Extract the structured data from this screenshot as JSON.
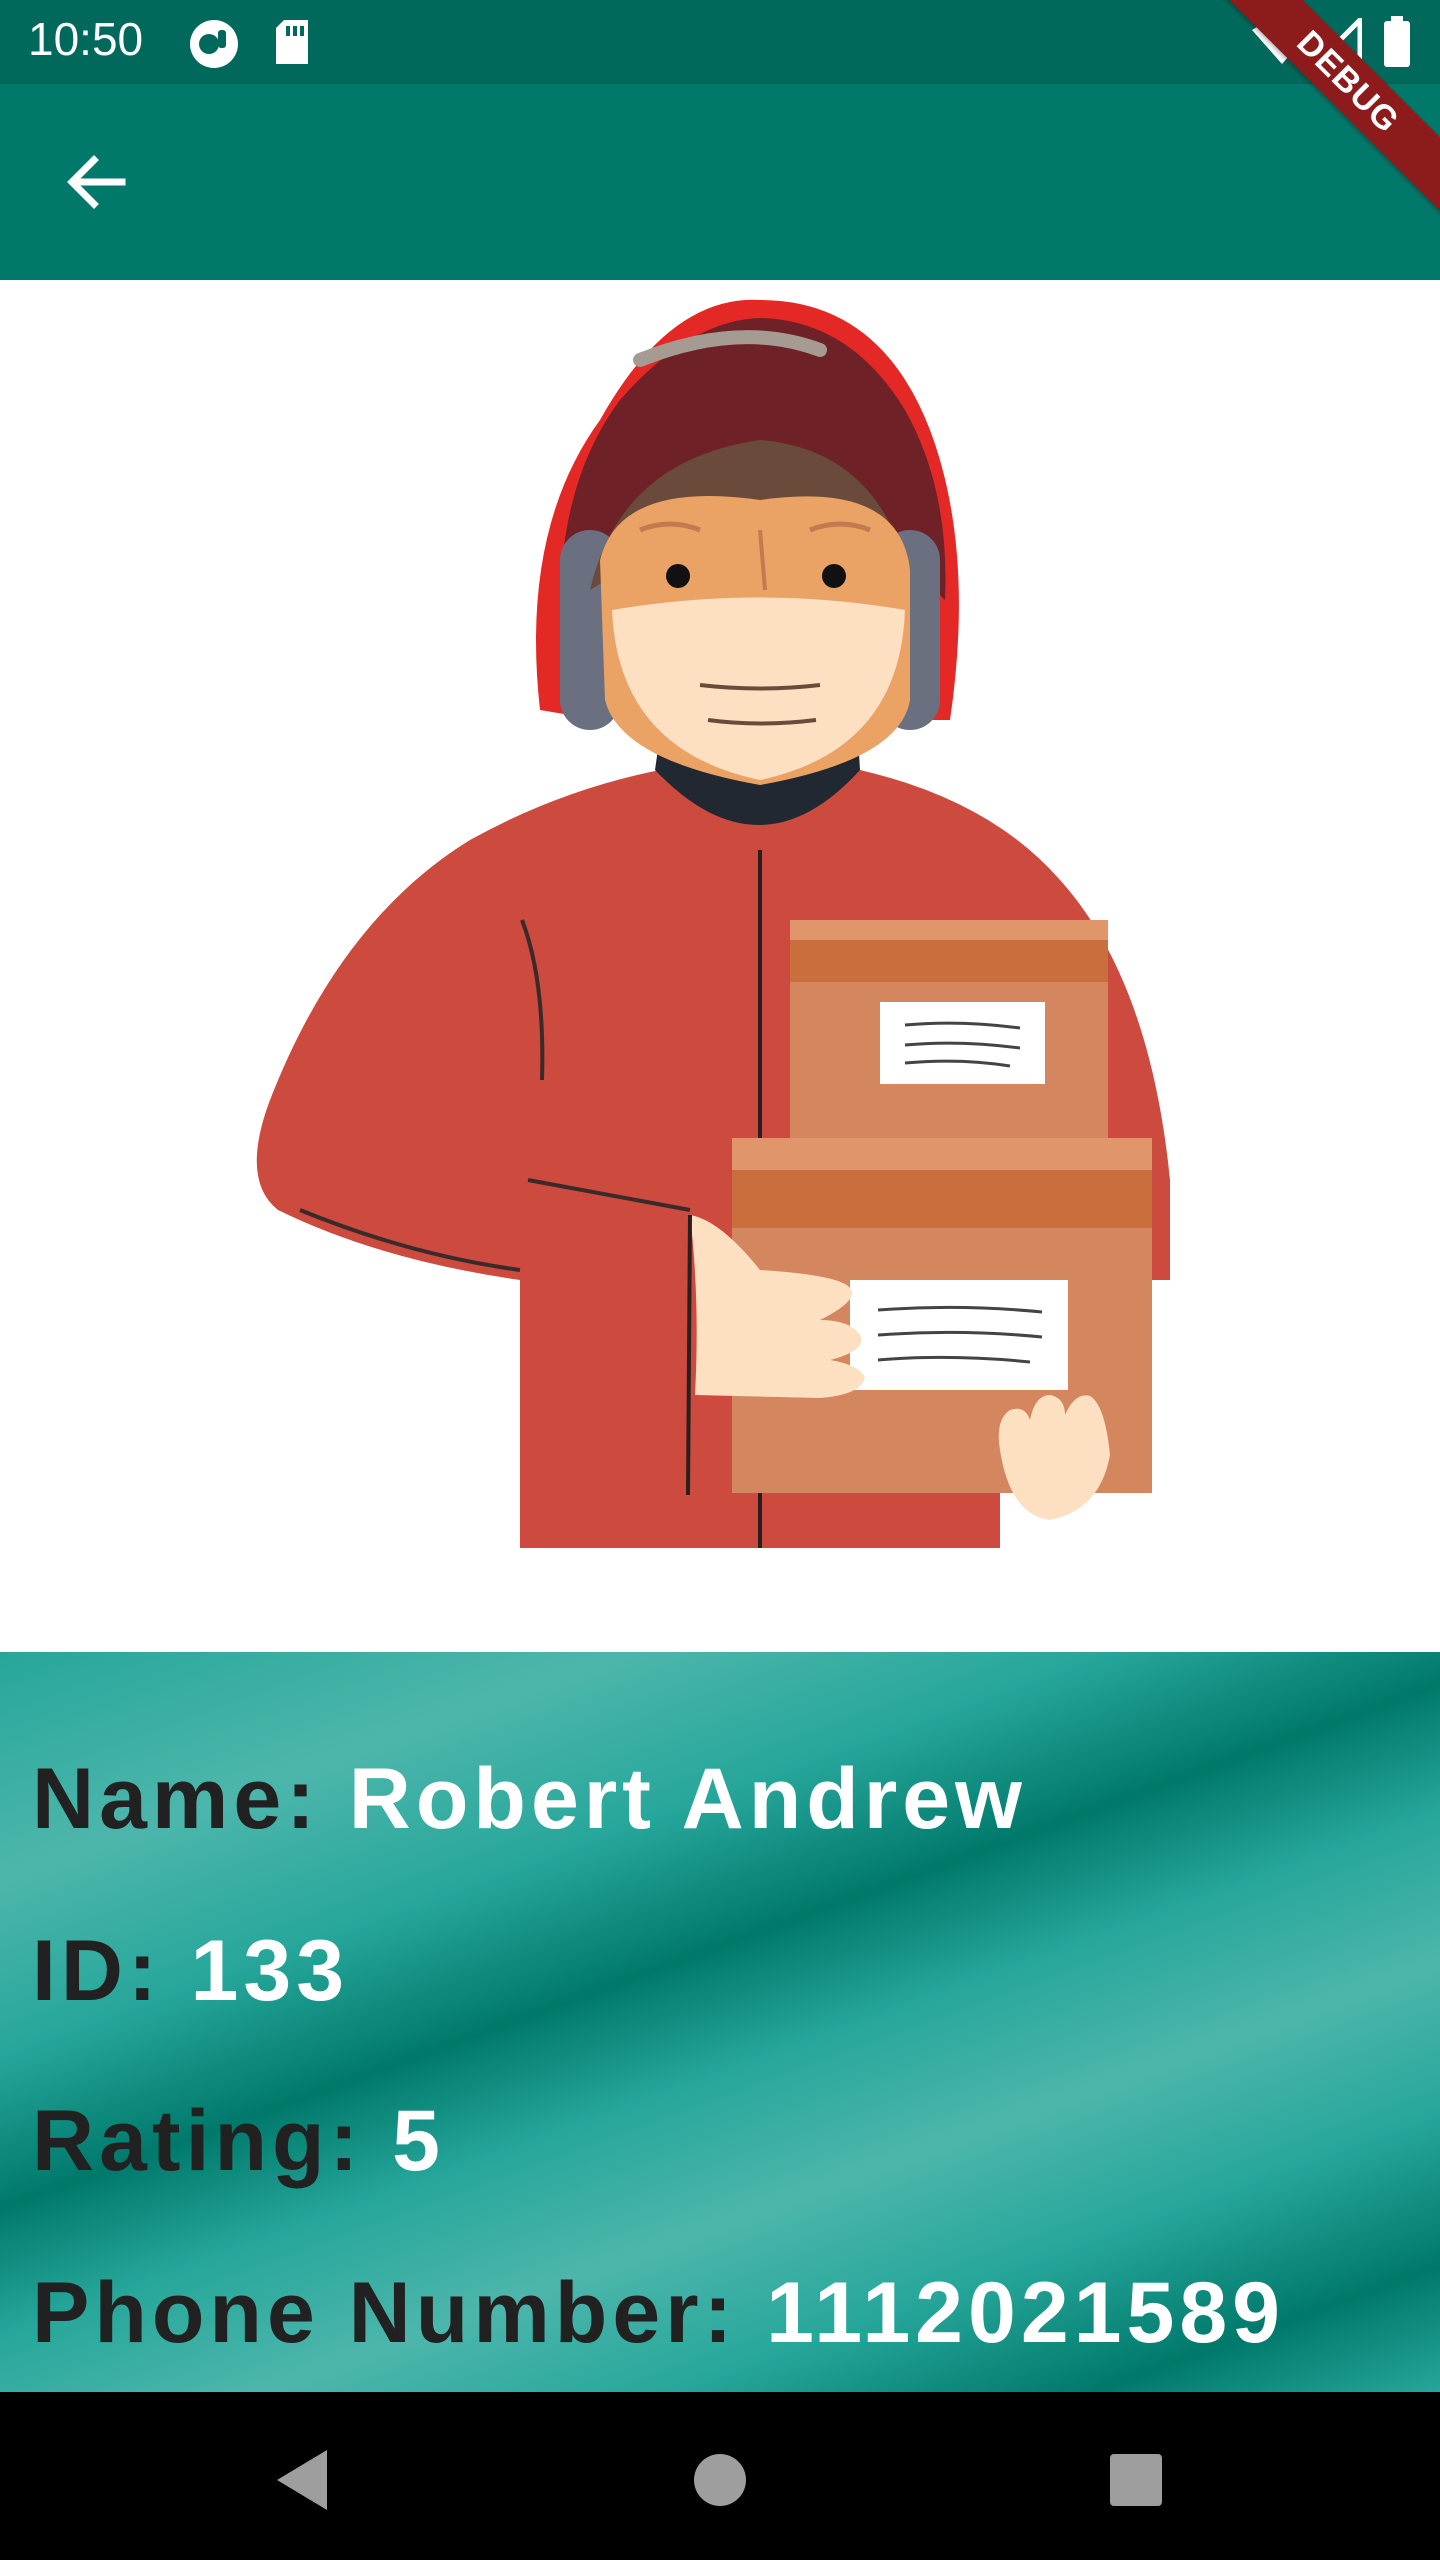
{
  "status_bar": {
    "time": "10:50",
    "icons": [
      "notification-icon",
      "sd-card-icon",
      "wifi-icon",
      "signal-icon",
      "battery-icon"
    ]
  },
  "app_bar": {
    "back_icon": "arrow-back-icon",
    "background_color": "#00796b"
  },
  "debug_banner": {
    "label": "DEBUG"
  },
  "hero": {
    "image": "delivery-courier-illustration"
  },
  "info": [
    {
      "label": "Name:",
      "value": "Robert Andrew"
    },
    {
      "label": "ID:",
      "value": "133"
    },
    {
      "label": "Rating:",
      "value": "5"
    },
    {
      "label": "Phone Number:",
      "value": "1112021589"
    }
  ],
  "nav_bar": {
    "icons": [
      "back-triangle-icon",
      "home-circle-icon",
      "recents-square-icon"
    ]
  },
  "colors": {
    "accent": "#00796b",
    "status": "#00695c",
    "panel": "#26a69a"
  }
}
